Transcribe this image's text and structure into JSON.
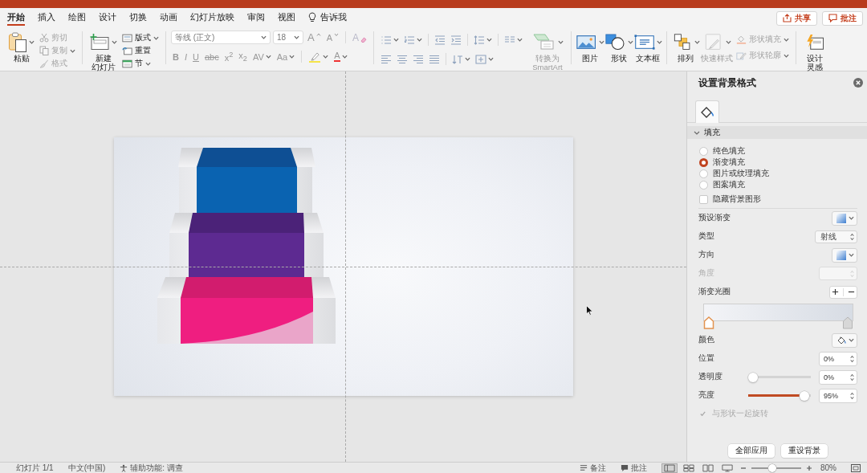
{
  "tabs": [
    {
      "label": "开始",
      "selected": true
    },
    {
      "label": "插入",
      "selected": false
    },
    {
      "label": "绘图",
      "selected": false
    },
    {
      "label": "设计",
      "selected": false
    },
    {
      "label": "切换",
      "selected": false
    },
    {
      "label": "动画",
      "selected": false
    },
    {
      "label": "幻灯片放映",
      "selected": false
    },
    {
      "label": "审阅",
      "selected": false
    },
    {
      "label": "视图",
      "selected": false
    }
  ],
  "tell_me": "告诉我",
  "share_button": "共享",
  "comments_button": "批注",
  "ribbon": {
    "paste": "粘贴",
    "clipboard": [
      {
        "label": "剪切",
        "disabled": true,
        "dropdown": false
      },
      {
        "label": "复制",
        "disabled": true,
        "dropdown": true
      },
      {
        "label": "格式",
        "disabled": true,
        "dropdown": false
      }
    ],
    "new_slide": [
      "新建",
      "幻灯片"
    ],
    "slide_tools": [
      {
        "label": "版式",
        "dropdown": true
      },
      {
        "label": "重置",
        "dropdown": false
      },
      {
        "label": "节",
        "dropdown": true
      }
    ],
    "font_name": "等线 (正文)",
    "font_size": "18",
    "grow_font": "A",
    "shrink_font": "A",
    "clear_formatting": "A",
    "text_styles": [
      {
        "kind": "bold",
        "label": "B",
        "dropdown": false
      },
      {
        "kind": "italic",
        "label": "I",
        "dropdown": false
      },
      {
        "kind": "underline",
        "label": "U",
        "dropdown": false
      },
      {
        "kind": "strikethrough",
        "label": "abc",
        "dropdown": false
      },
      {
        "kind": "superscript",
        "label": "x$^{2}$",
        "dropdown": false
      },
      {
        "kind": "subscript",
        "label": "x$_{2}$",
        "dropdown": false
      },
      {
        "kind": "spacing",
        "label": "AV",
        "dropdown": true
      },
      {
        "kind": "case",
        "label": "Aa",
        "dropdown": true
      }
    ],
    "font_color": "A",
    "smartart": {
      "label": "转换为\nSmartArt",
      "disabled": true
    },
    "picture": "图片",
    "shapes": "形状",
    "text_box": "文本框",
    "arrange": "排列",
    "quick_styles": {
      "label": "快速样式",
      "disabled": true
    },
    "shape_format": [
      {
        "label": "形状填充",
        "disabled": true
      },
      {
        "label": "形状轮廓",
        "disabled": true
      }
    ],
    "design_ideas": [
      "设计",
      "灵感"
    ]
  },
  "format_pane": {
    "title": "设置背景格式",
    "section": {
      "label": "填充",
      "expanded": true
    },
    "fill_options": [
      {
        "label": "纯色填充",
        "selected": false
      },
      {
        "label": "渐变填充",
        "selected": true
      },
      {
        "label": "图片或纹理填充",
        "selected": false
      },
      {
        "label": "图案填充",
        "selected": false
      }
    ],
    "hide_background": {
      "label": "隐藏背景图形",
      "checked": false
    },
    "settings": [
      {
        "kind": "swatch",
        "label": "预设渐变",
        "disabled": false
      },
      {
        "kind": "select",
        "label": "类型",
        "value": "射线",
        "disabled": false
      },
      {
        "kind": "swatch",
        "label": "方向",
        "disabled": false
      },
      {
        "kind": "spinner",
        "label": "角度",
        "disabled": true
      }
    ],
    "gradient": {
      "label": "渐变光圈",
      "stops": [
        {
          "selected": true
        },
        {
          "selected": false
        }
      ]
    },
    "color_label": "颜色",
    "properties": [
      {
        "kind": "spinner",
        "label": "位置",
        "value": "0%"
      },
      {
        "kind": "slider",
        "label": "透明度",
        "level": 0,
        "value": "0%"
      },
      {
        "kind": "slider",
        "label": "亮度",
        "level": 0.97,
        "value": "95%"
      }
    ],
    "rotate_with_shape": {
      "label": "与形状一起旋转",
      "checked": true,
      "disabled": true
    },
    "buttons": [
      "全部应用",
      "重设背景"
    ]
  },
  "status_bar": {
    "slide_number": "幻灯片 1/1",
    "language": "中文(中国)",
    "accessibility": "辅助功能: 调查",
    "notes": "备注",
    "comments": "批注",
    "views": [
      {
        "selected": true
      },
      {
        "selected": false
      },
      {
        "selected": false
      },
      {
        "selected": false
      }
    ],
    "zoom": {
      "level": 0.4,
      "value": "80%"
    }
  }
}
